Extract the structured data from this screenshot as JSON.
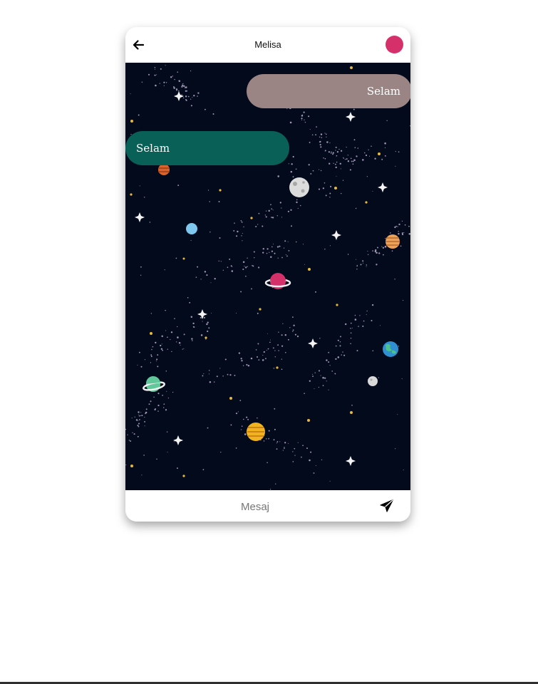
{
  "header": {
    "title": "Melisa",
    "back_icon": "arrow-left-icon",
    "avatar_color": "#d6306b"
  },
  "messages": [
    {
      "direction": "sent",
      "text": "Selam",
      "color": "#9a8584"
    },
    {
      "direction": "received",
      "text": "Selam",
      "color": "#086056"
    }
  ],
  "composer": {
    "placeholder": "Mesaj",
    "value": "",
    "send_icon": "send-icon"
  },
  "colors": {
    "chat_background": "#030a1c",
    "page_background": "#ffffff"
  }
}
